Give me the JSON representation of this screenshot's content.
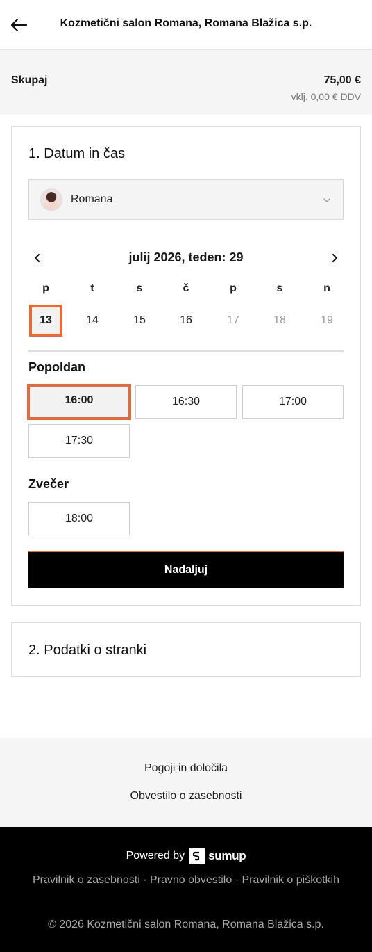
{
  "header": {
    "title": "Kozmetični salon Romana, Romana Blažica s.p."
  },
  "summary": {
    "label": "Skupaj",
    "price": "75,00 €",
    "vat": "vklj. 0,00 € DDV"
  },
  "step1": {
    "title": "1. Datum in čas",
    "staff": {
      "selected": "Romana"
    },
    "calendar": {
      "title": "julij 2026, teden: 29",
      "weekdays": [
        "p",
        "t",
        "s",
        "č",
        "p",
        "s",
        "n"
      ],
      "days": [
        {
          "label": "13",
          "state": "selected"
        },
        {
          "label": "14",
          "state": "available"
        },
        {
          "label": "15",
          "state": "available"
        },
        {
          "label": "16",
          "state": "available"
        },
        {
          "label": "17",
          "state": "disabled"
        },
        {
          "label": "18",
          "state": "disabled"
        },
        {
          "label": "19",
          "state": "disabled"
        }
      ]
    },
    "afternoon": {
      "label": "Popoldan",
      "slots": [
        "16:00",
        "16:30",
        "17:00",
        "17:30"
      ],
      "selected": "16:00"
    },
    "evening": {
      "label": "Zvečer",
      "slots": [
        "18:00"
      ]
    },
    "continue_label": "Nadaljuj"
  },
  "step2": {
    "title": "2. Podatki o stranki"
  },
  "links": {
    "terms": "Pogoji in določila",
    "privacy_notice": "Obvestilo o zasebnosti"
  },
  "footer": {
    "powered_by": "Powered by",
    "brand": "sumup",
    "legal": [
      "Pravilnik o zasebnosti",
      "Pravno obvestilo",
      "Pravilnik o piškotkih"
    ],
    "separator": " · ",
    "copyright": "© 2026 Kozmetični salon Romana, Romana Blažica s.p."
  },
  "colors": {
    "accent": "#e66b3a",
    "primary_button": "#000000",
    "footer_bg": "#000000",
    "muted_bg": "#f5f5f5"
  }
}
